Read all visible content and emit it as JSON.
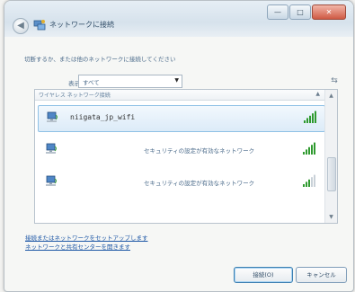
{
  "window": {
    "title": "ネットワークに接続",
    "controls": {
      "minimize": "—",
      "maximize": "□",
      "close": "✕"
    }
  },
  "main": {
    "prompt": "切断するか、または他のネットワークに接続してください",
    "show_label": "表示",
    "show_select": {
      "value": "すべて"
    }
  },
  "list": {
    "group_header": "ワイヤレス ネットワーク接続",
    "networks": [
      {
        "name": "niigata_jp_wifi",
        "status": "",
        "signal_bars": 5,
        "selected": true
      },
      {
        "name": "",
        "status": "セキュリティの設定が有効なネットワーク",
        "signal_bars": 5,
        "selected": false
      },
      {
        "name": "",
        "status": "セキュリティの設定が有効なネットワーク",
        "signal_bars": 3,
        "selected": false
      }
    ]
  },
  "links": {
    "setup": "接続またはネットワークをセットアップします",
    "network_center": "ネットワークと共有センターを開きます"
  },
  "buttons": {
    "connect": "接続(O)",
    "cancel": "キャンセル"
  },
  "colors": {
    "signal_on": "#2f9a2f",
    "signal_off": "#c9d1d8"
  }
}
